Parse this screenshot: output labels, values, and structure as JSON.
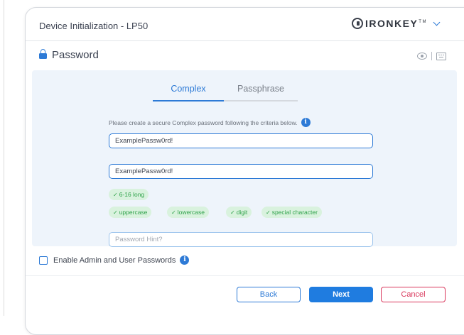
{
  "header": {
    "title": "Device Initialization - LP50",
    "brand": "IRONKEY",
    "brand_tm": "TM"
  },
  "section": {
    "title": "Password"
  },
  "tabs": [
    {
      "label": "Complex",
      "active": true
    },
    {
      "label": "Passphrase",
      "active": false
    }
  ],
  "instruction": "Please create a secure Complex password following the criteria below.",
  "fields": {
    "password": "ExamplePassw0rd!",
    "confirm": "ExamplePassw0rd!",
    "hint_placeholder": "Password Hint?"
  },
  "criteria": [
    "6-16 long",
    "uppercase",
    "lowercase",
    "digit",
    "special character"
  ],
  "admin": {
    "label": "Enable Admin and User Passwords",
    "checked": false
  },
  "buttons": {
    "back": "Back",
    "next": "Next",
    "cancel": "Cancel"
  },
  "colors": {
    "accent": "#2d7ad6",
    "primary_button": "#1f7ce0",
    "cancel": "#d9365b",
    "success": "#2fa24a",
    "success_bg": "#d9f2de",
    "panel_bg": "#eef4fb"
  },
  "icons": {
    "info": "i",
    "check": "✓"
  }
}
